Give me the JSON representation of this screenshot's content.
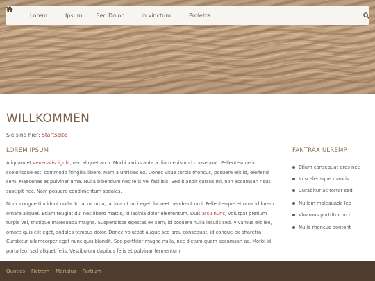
{
  "nav": {
    "items": [
      {
        "label": "Lorem",
        "has_dropdown": true
      },
      {
        "label": "Ipsum",
        "has_dropdown": false
      },
      {
        "label": "Sed Dolor",
        "has_dropdown": true
      },
      {
        "label": "In vinctum",
        "has_dropdown": true
      },
      {
        "label": "Proletra",
        "has_dropdown": false
      }
    ],
    "icons": {
      "home": "home-icon",
      "search": "search-icon",
      "dropdown": "chevron-down-icon"
    }
  },
  "page": {
    "title": "WILLKOMMEN",
    "breadcrumb_prefix": "Sie sind hier:",
    "breadcrumb_link": "Startseite"
  },
  "main": {
    "heading": "LOREM IPSUM",
    "p1": {
      "t1": "Aliquam et ",
      "link": "venenatis ligula",
      "t2": ", nec aliquet arcu. Morbi varius ante a diam euismod consequat. Pellentesque id scelerisque est, commodo fringilla libero. Nam a ultricies ex. Donec vitae turpis rhoncus, posuere elit id, eleifend sem. Maecenas et pulvinar urna. Nulla bibendum nec felis vel facilisis. Sed blandit cursus mi, non accumsan risus suscipit nec. Nam posuere condimentum sodales."
    },
    "p2": {
      "t1": "Nunc congue tincidunt nulla. In lacus urna, lacinia ut orci eget, laoreet hendrerit orci. Pellentesque et urna id lorem ornare aliquet. Etiam feugiat dui nec libero mattis, id lacinia dolor elementum. Duis ",
      "link": "arcu nunc",
      "t2": ", volutpat pretium turpis vel, tristique malesuada magna. Suspendisse egestas ex sem, id posuere nulla iaculis sed. Vivamus elit leo, ornare quis elit eget, sodales tempus dolor. Donec volutpat augue sed arcu consequat, id congue ex pharetra. Curabitur ullamcorper eget nunc quis blandit. Sed porttitor magna nulla, nec dictum quam accumsan ac. Morbi id porta leo, sed aliquet felis. Vestibulum dapibus felis et pulvinar fermentum."
    }
  },
  "aside": {
    "heading": "FANTRAX ULREMP",
    "items": [
      "Etiam consequat eros nec",
      "In scelerisque mauris",
      "Curabitur ac tortor sed",
      "Nullam malesuada leo",
      "Vivamus porttitor orci",
      "Nulla rhoncus pontent"
    ]
  },
  "footer": {
    "links": [
      "Quntias",
      "Fictram",
      "Mariplus",
      "Partium"
    ]
  },
  "colors": {
    "accent": "#b03a3a",
    "title": "#7a6048",
    "footer_bg": "#4e3c2e",
    "footer_link": "#c9a977",
    "navbar_bg": "#f7f5f2"
  }
}
